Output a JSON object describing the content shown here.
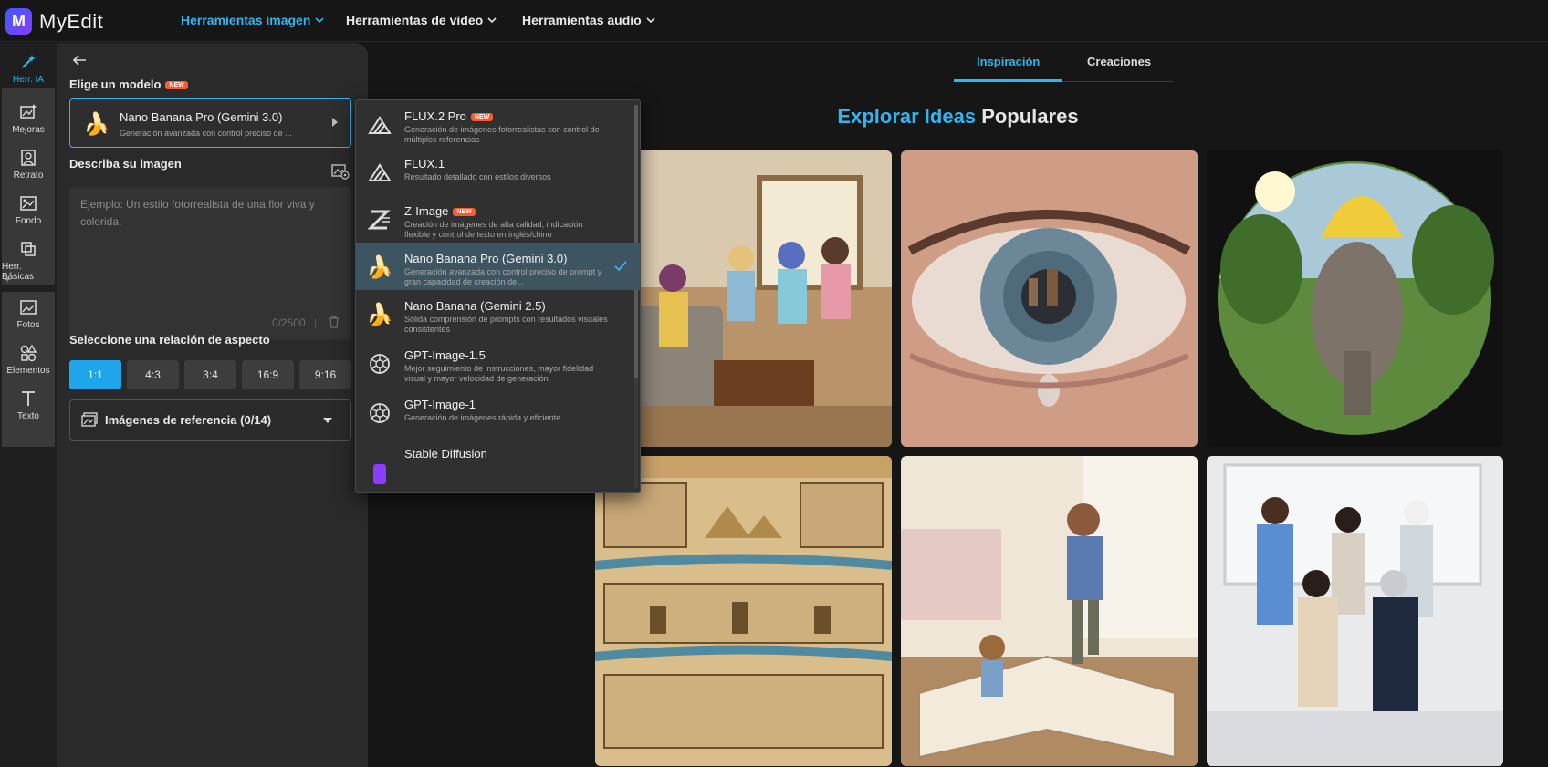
{
  "app": {
    "name": "MyEdit",
    "logo_letter": "M"
  },
  "topnav": [
    {
      "label": "Herramientas imagen",
      "active": true
    },
    {
      "label": "Herramientas de video",
      "active": false
    },
    {
      "label": "Herramientas audio",
      "active": false
    }
  ],
  "rail": [
    {
      "label": "Herr. IA",
      "icon": "magic-wand-icon",
      "active": true
    },
    {
      "label": "Mejoras",
      "icon": "enhance-icon"
    },
    {
      "label": "Retrato",
      "icon": "portrait-icon"
    },
    {
      "label": "Fondo",
      "icon": "background-icon"
    },
    {
      "label": "Herr. Básicas",
      "icon": "crop-icon"
    },
    {
      "label": "Fotos",
      "icon": "photo-icon"
    },
    {
      "label": "Elementos",
      "icon": "shapes-icon"
    },
    {
      "label": "Texto",
      "icon": "text-icon"
    }
  ],
  "panel": {
    "model_label": "Elige un modelo",
    "new_badge": "NEW",
    "selected_model": {
      "title": "Nano Banana Pro (Gemini 3.0)",
      "subtitle": "Generación avanzada con control preciso de ...",
      "emoji": "🍌"
    },
    "describe_label": "Describa su imagen",
    "prompt_placeholder": "Ejemplo: Un estilo fotorrealista de una flor viva y colorida.",
    "char_count": "0/2500",
    "aspect_label": "Seleccione una relación de aspecto",
    "aspect_ratios": [
      "1:1",
      "4:3",
      "3:4",
      "16:9",
      "9:16"
    ],
    "aspect_active": "1:1",
    "reference_label": "Imágenes de referencia (0/14)"
  },
  "dropdown": [
    {
      "title": "FLUX.2 Pro",
      "badge": "NEW",
      "desc": "Generación de imágenes fotorrealistas con control de múltiples referencias",
      "icon": "flux-icon"
    },
    {
      "title": "FLUX.1",
      "desc": "Resultado detallado con estilos diversos",
      "icon": "flux-icon"
    },
    {
      "title": "Z-Image",
      "badge": "NEW",
      "desc": "Creación de imágenes de alta calidad, indicación flexible y control de texto en inglés/chino",
      "icon": "z-image-icon"
    },
    {
      "title": "Nano Banana Pro (Gemini 3.0)",
      "desc": "Generación avanzada con control preciso de prompt y gran capacidad de creación de...",
      "icon": "banana-icon",
      "selected": true
    },
    {
      "title": "Nano Banana (Gemini 2.5)",
      "desc": "Sólida comprensión de prompts con resultados visuales consistentes",
      "icon": "banana-icon"
    },
    {
      "title": "GPT-Image-1.5",
      "desc": "Mejor seguimiento de instrucciones, mayor fidelidad visual y mayor velocidad de generación.",
      "icon": "openai-icon"
    },
    {
      "title": "GPT-Image-1",
      "desc": "Generación de imágenes rápida y eficiente",
      "icon": "openai-icon"
    },
    {
      "title": "Stable Diffusion",
      "desc": "",
      "icon": "stable-diffusion-icon"
    }
  ],
  "main": {
    "tabs": [
      {
        "label": "Inspiración",
        "active": true
      },
      {
        "label": "Creaciones",
        "active": false
      }
    ],
    "heading_highlight": "Explorar Ideas",
    "heading_rest": "Populares",
    "gallery": [
      "anime-girls-living-room",
      "eye-with-tear",
      "fisheye-elephant-banana",
      "egyptian-dynasties-poster",
      "girl-stepping-out-of-book",
      "professionals-group-photo"
    ]
  },
  "colors": {
    "accent": "#34b4ee",
    "badge": "#ff5a2c",
    "selected_row": "#3d5560"
  }
}
